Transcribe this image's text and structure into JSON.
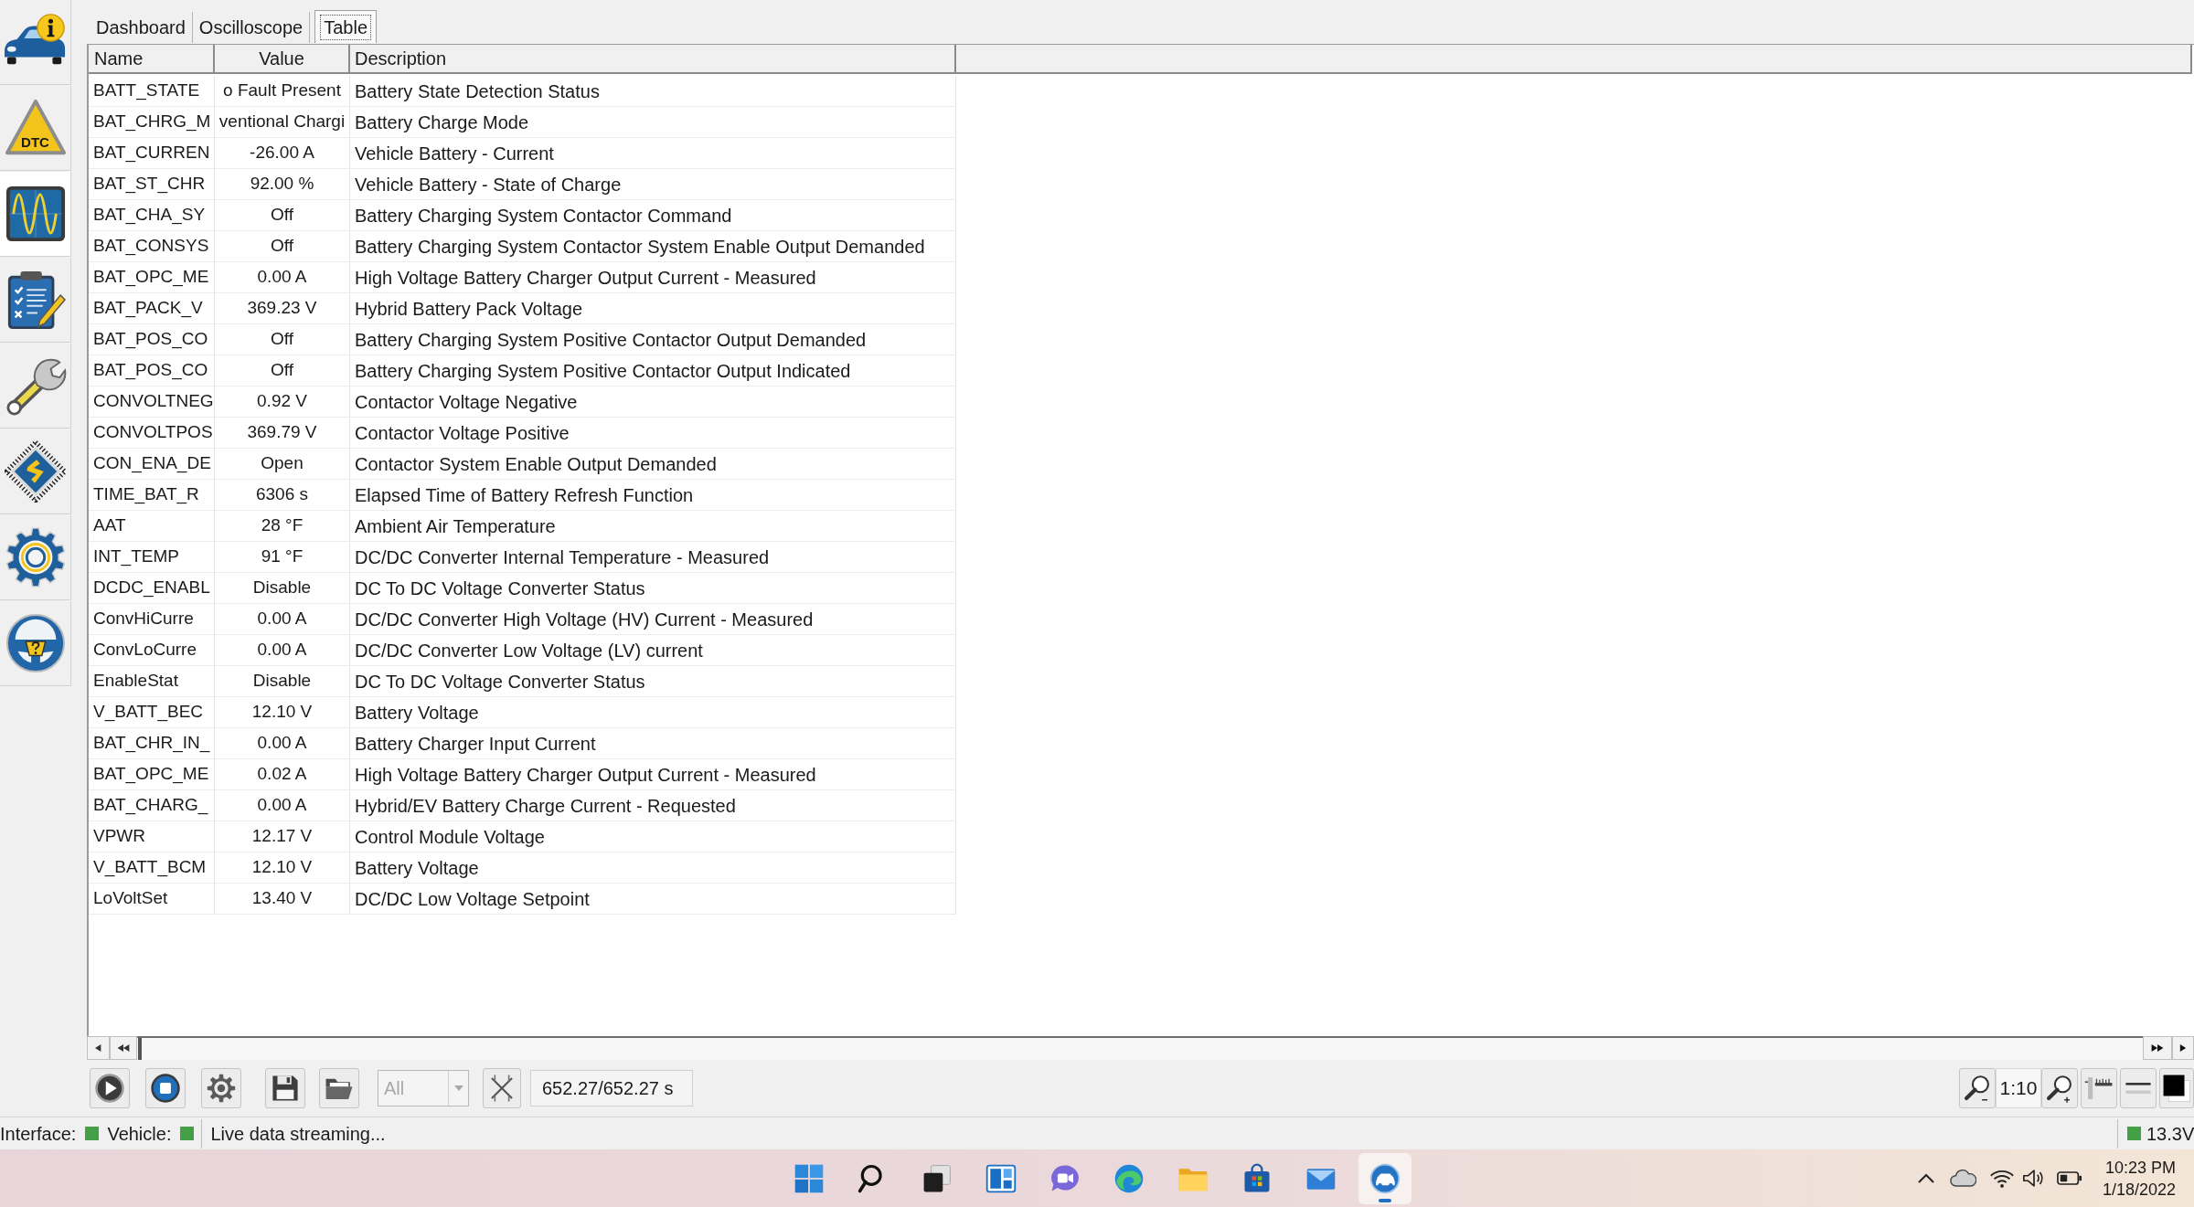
{
  "sidebar": {
    "items": [
      {
        "selected": false
      },
      {
        "selected": false,
        "label": "DTC"
      },
      {
        "selected": true
      },
      {
        "selected": false
      },
      {
        "selected": false
      },
      {
        "selected": false
      },
      {
        "selected": false
      },
      {
        "selected": false
      }
    ]
  },
  "tabs": [
    {
      "label": "Dashboard",
      "selected": false
    },
    {
      "label": "Oscilloscope",
      "selected": false
    },
    {
      "label": "Table",
      "selected": true
    }
  ],
  "table": {
    "columns": [
      "Name",
      "Value",
      "Description"
    ],
    "rows": [
      {
        "name": "BATT_STATE",
        "value": "o Fault Present",
        "description": "Battery State Detection Status"
      },
      {
        "name": "BAT_CHRG_M",
        "value": "ventional Chargi",
        "description": "Battery Charge Mode"
      },
      {
        "name": "BAT_CURREN",
        "value": "-26.00 A",
        "description": "Vehicle Battery - Current"
      },
      {
        "name": "BAT_ST_CHR",
        "value": "92.00 %",
        "description": "Vehicle Battery - State of Charge"
      },
      {
        "name": "BAT_CHA_SY",
        "value": "Off",
        "description": "Battery Charging System Contactor Command"
      },
      {
        "name": "BAT_CONSYS",
        "value": "Off",
        "description": "Battery Charging System Contactor System Enable Output Demanded"
      },
      {
        "name": "BAT_OPC_ME",
        "value": "0.00 A",
        "description": "High Voltage Battery Charger Output Current - Measured"
      },
      {
        "name": "BAT_PACK_V",
        "value": "369.23 V",
        "description": "Hybrid Battery Pack Voltage"
      },
      {
        "name": "BAT_POS_CO",
        "value": "Off",
        "description": "Battery Charging System Positive Contactor Output Demanded"
      },
      {
        "name": "BAT_POS_CO",
        "value": "Off",
        "description": "Battery Charging System Positive Contactor Output Indicated"
      },
      {
        "name": "CONVOLTNEG",
        "value": "0.92 V",
        "description": "Contactor Voltage Negative"
      },
      {
        "name": "CONVOLTPOS",
        "value": "369.79 V",
        "description": "Contactor Voltage Positive"
      },
      {
        "name": "CON_ENA_DE",
        "value": "Open",
        "description": "Contactor System Enable Output Demanded"
      },
      {
        "name": "TIME_BAT_R",
        "value": "6306 s",
        "description": "Elapsed Time of Battery Refresh Function"
      },
      {
        "name": "AAT",
        "value": "28 °F",
        "description": "Ambient Air Temperature"
      },
      {
        "name": "INT_TEMP",
        "value": "91 °F",
        "description": "DC/DC Converter Internal Temperature - Measured"
      },
      {
        "name": "DCDC_ENABL",
        "value": "Disable",
        "description": "DC To DC Voltage Converter Status"
      },
      {
        "name": "ConvHiCurre",
        "value": "0.00 A",
        "description": "DC/DC Converter High Voltage (HV) Current - Measured"
      },
      {
        "name": "ConvLoCurre",
        "value": "0.00 A",
        "description": "DC/DC Converter Low Voltage (LV) current"
      },
      {
        "name": "EnableStat",
        "value": "Disable",
        "description": "DC To DC Voltage Converter Status"
      },
      {
        "name": "V_BATT_BEC",
        "value": "12.10 V",
        "description": "Battery Voltage"
      },
      {
        "name": "BAT_CHR_IN_",
        "value": "0.00 A",
        "description": "Battery Charger Input Current"
      },
      {
        "name": "BAT_OPC_ME",
        "value": "0.02 A",
        "description": "High Voltage Battery Charger Output Current - Measured"
      },
      {
        "name": "BAT_CHARG_",
        "value": "0.00 A",
        "description": "Hybrid/EV Battery Charge Current - Requested"
      },
      {
        "name": "VPWR",
        "value": "12.17 V",
        "description": "Control Module Voltage"
      },
      {
        "name": "V_BATT_BCM",
        "value": "12.10 V",
        "description": "Battery Voltage"
      },
      {
        "name": "LoVoltSet",
        "value": "13.40 V",
        "description": "DC/DC Low Voltage Setpoint"
      }
    ]
  },
  "toolbar": {
    "filter": {
      "value": "All",
      "disabled": true
    },
    "time": "652.27/652.27 s",
    "zoom": "1:10"
  },
  "status_bar": {
    "indicators": [
      {
        "label": "Interface:",
        "color": "#43a047"
      },
      {
        "label": "Vehicle:",
        "color": "#43a047"
      }
    ],
    "message": "Live data streaming...",
    "voltage": {
      "text": "13.3V",
      "color": "#43a047"
    }
  },
  "taskbar": {
    "apps": [
      {
        "active": false
      },
      {
        "active": false
      },
      {
        "active": false
      },
      {
        "active": false
      },
      {
        "active": false
      },
      {
        "active": false
      },
      {
        "active": false
      },
      {
        "active": false
      },
      {
        "active": false
      },
      {
        "active": true
      }
    ],
    "clock": {
      "time": "10:23 PM",
      "date": "1/18/2022"
    }
  }
}
